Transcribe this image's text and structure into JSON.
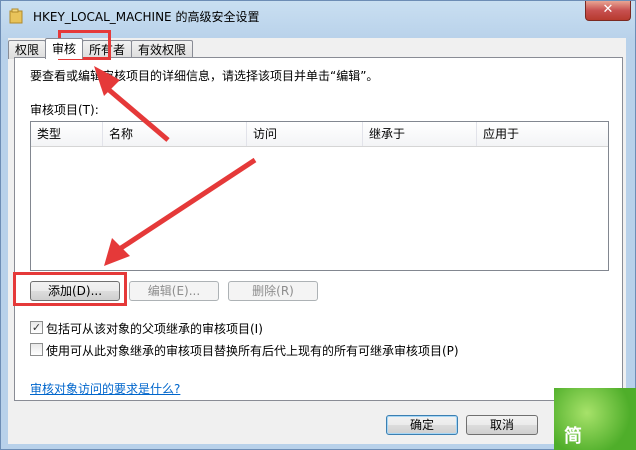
{
  "window": {
    "title": "HKEY_LOCAL_MACHINE 的高级安全设置",
    "close_glyph": "✕"
  },
  "tabs": [
    {
      "label": "权限"
    },
    {
      "label": "审核"
    },
    {
      "label": "所有者"
    },
    {
      "label": "有效权限"
    }
  ],
  "panel": {
    "instruction": "要查看或编辑审核项目的详细信息，请选择该项目并单击“编辑”。",
    "list_label": "审核项目(T):",
    "columns": [
      "类型",
      "名称",
      "访问",
      "继承于",
      "应用于"
    ],
    "buttons": {
      "add": "添加(D)...",
      "edit": "编辑(E)...",
      "remove": "删除(R)"
    },
    "checkbox_inherit": {
      "label": "包括可从该对象的父项继承的审核项目(I)",
      "checked": true,
      "mark": "✓"
    },
    "checkbox_replace": {
      "label": "使用可从此对象继承的审核项目替换所有后代上现有的所有可继承审核项目(P)",
      "checked": false
    },
    "link": "审核对象访问的要求是什么?"
  },
  "footer": {
    "ok": "确定",
    "cancel": "取消"
  },
  "badge": {
    "glyph": "简"
  },
  "colors": {
    "highlight": "#e53939",
    "link": "#0066cc"
  }
}
